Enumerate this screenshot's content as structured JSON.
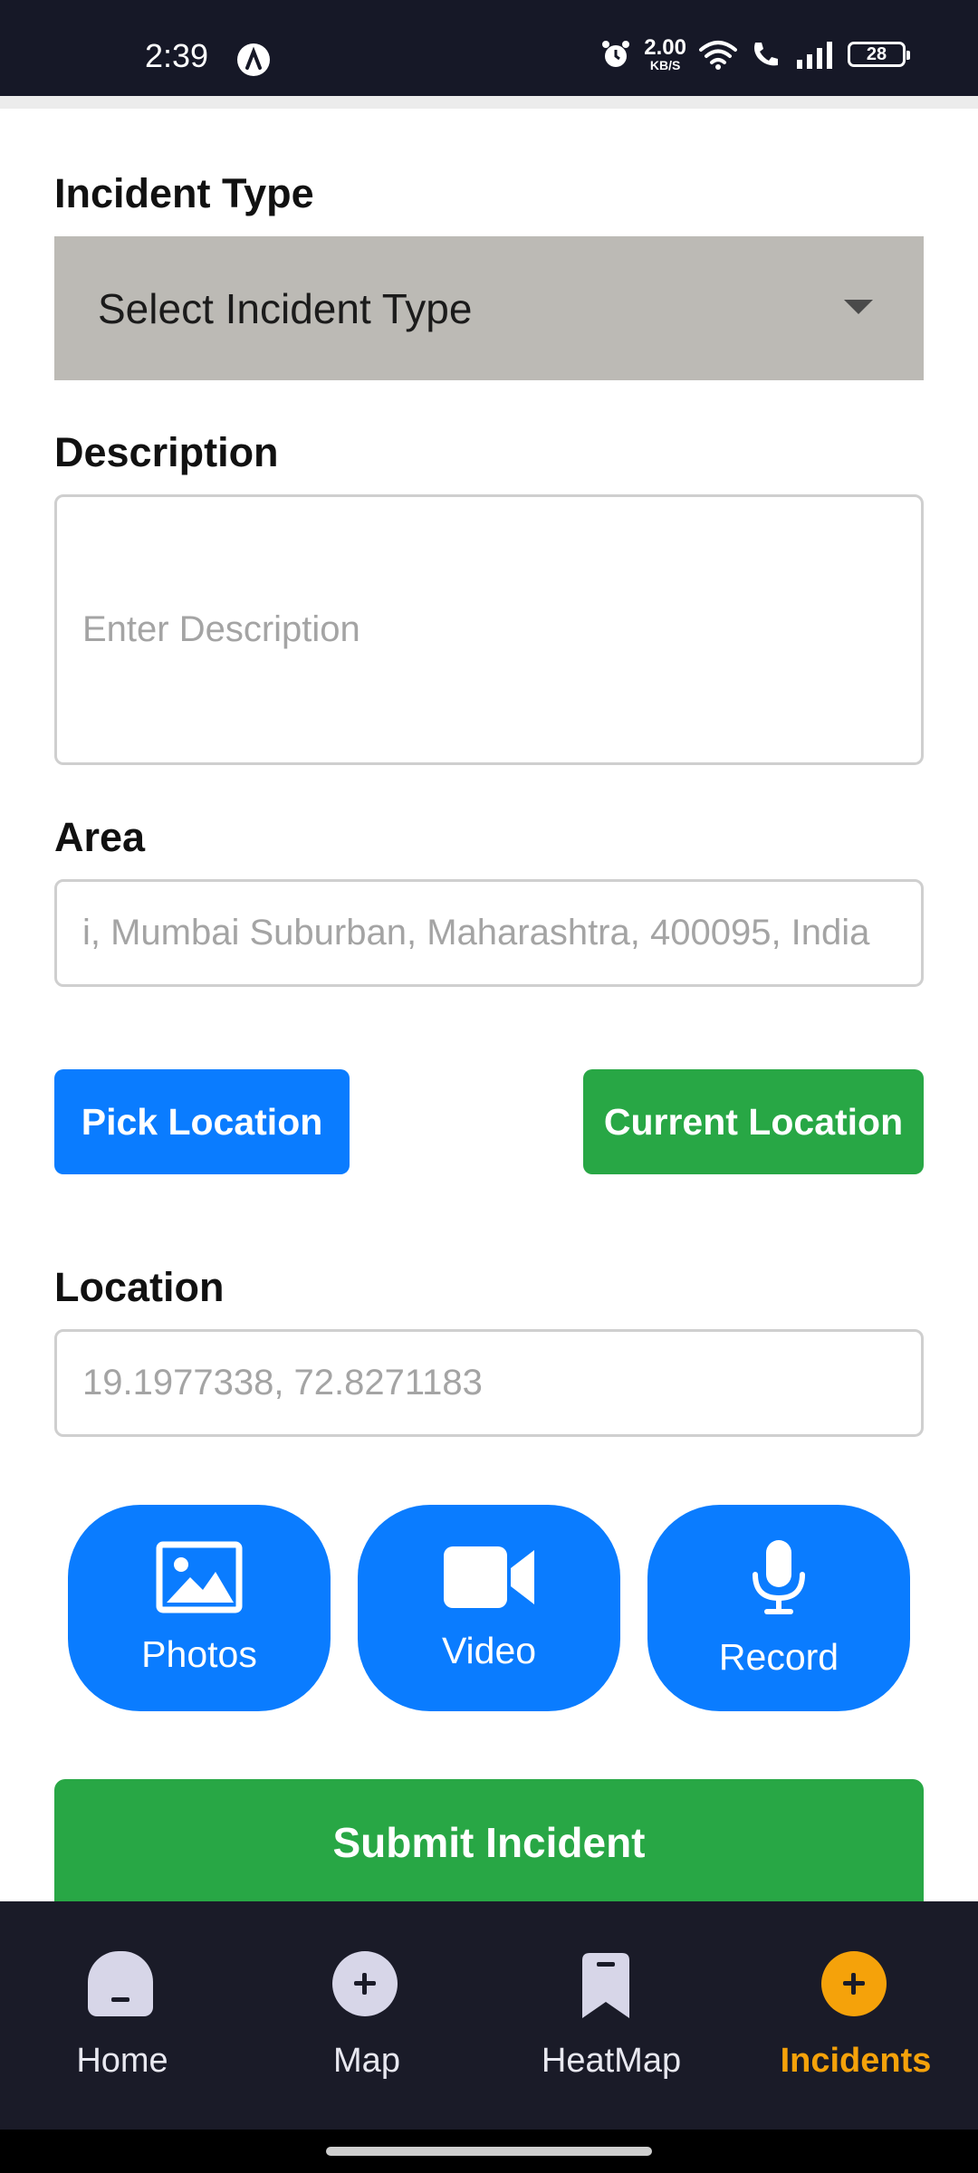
{
  "status_bar": {
    "time": "2:39",
    "net_speed_value": "2.00",
    "net_speed_unit": "KB/S",
    "battery": "28"
  },
  "form": {
    "incident_type_label": "Incident Type",
    "incident_type_value": "Select Incident Type",
    "description_label": "Description",
    "description_placeholder": "Enter Description",
    "area_label": "Area",
    "area_value": "i, Mumbai Suburban, Maharashtra, 400095, India",
    "pick_location": "Pick Location",
    "current_location": "Current Location",
    "location_label": "Location",
    "location_value": "19.1977338, 72.8271183",
    "photos": "Photos",
    "video": "Video",
    "record": "Record",
    "submit": "Submit Incident"
  },
  "bottom_nav": {
    "items": [
      {
        "label": "Home",
        "icon": "home-icon"
      },
      {
        "label": "Map",
        "icon": "plus-circle-icon"
      },
      {
        "label": "HeatMap",
        "icon": "bookmark-icon"
      },
      {
        "label": "Incidents",
        "icon": "plus-circle-icon",
        "active": true
      }
    ]
  },
  "colors": {
    "primary_blue": "#0a7cff",
    "success_green": "#28a745",
    "active_tab": "#f5a20a",
    "nav_background": "#1a1b28"
  }
}
